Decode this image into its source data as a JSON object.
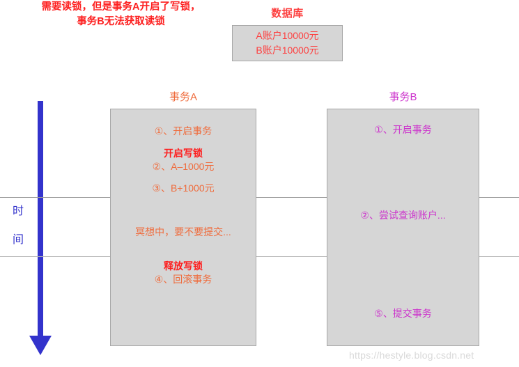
{
  "database": {
    "title": "数据库",
    "lines": [
      "A账户10000元",
      "B账户10000元"
    ]
  },
  "time_axis": {
    "label_char_1": "时",
    "label_char_2": "间",
    "color": "#3333cc",
    "direction": "downward-arrow"
  },
  "transactions": [
    {
      "id": "a",
      "title": "事务A",
      "color": "#ef6c3d",
      "steps": [
        {
          "key": "step_1",
          "text": "①、开启事务",
          "style": "normal"
        },
        {
          "key": "lock_open",
          "text": "开启写锁",
          "style": "highlight"
        },
        {
          "key": "step_2",
          "text": "②、A–1000元",
          "style": "normal"
        },
        {
          "key": "step_3",
          "text": "③、B+1000元",
          "style": "normal"
        },
        {
          "key": "thinking",
          "text": "冥想中，要不要提交...",
          "style": "normal"
        },
        {
          "key": "lock_release",
          "text": "释放写锁",
          "style": "highlight"
        },
        {
          "key": "step_4",
          "text": "④、回滚事务",
          "style": "normal"
        }
      ]
    },
    {
      "id": "b",
      "title": "事务B",
      "color": "#cc33cc",
      "steps": [
        {
          "key": "step_1",
          "text": "①、开启事务",
          "style": "normal"
        },
        {
          "key": "step_2",
          "text": "②、尝试查询账户...",
          "style": "normal"
        },
        {
          "key": "warning_line_1",
          "text": "需要读锁，但是事务A开启了写锁，",
          "style": "highlight"
        },
        {
          "key": "warning_line_2",
          "text": "事务B无法获取读锁",
          "style": "highlight"
        },
        {
          "key": "step_5",
          "text": "⑤、提交事务",
          "style": "normal"
        }
      ]
    }
  ],
  "colors": {
    "database_text": "#fd4040",
    "transaction_a": "#ef6c3d",
    "transaction_b": "#cc33cc",
    "highlight_red": "#fd2020",
    "box_fill": "#d6d6d6",
    "box_border": "#a6a6a6",
    "divider": "#9a9a9a"
  },
  "watermark": "https://hestyle.blog.csdn.net"
}
